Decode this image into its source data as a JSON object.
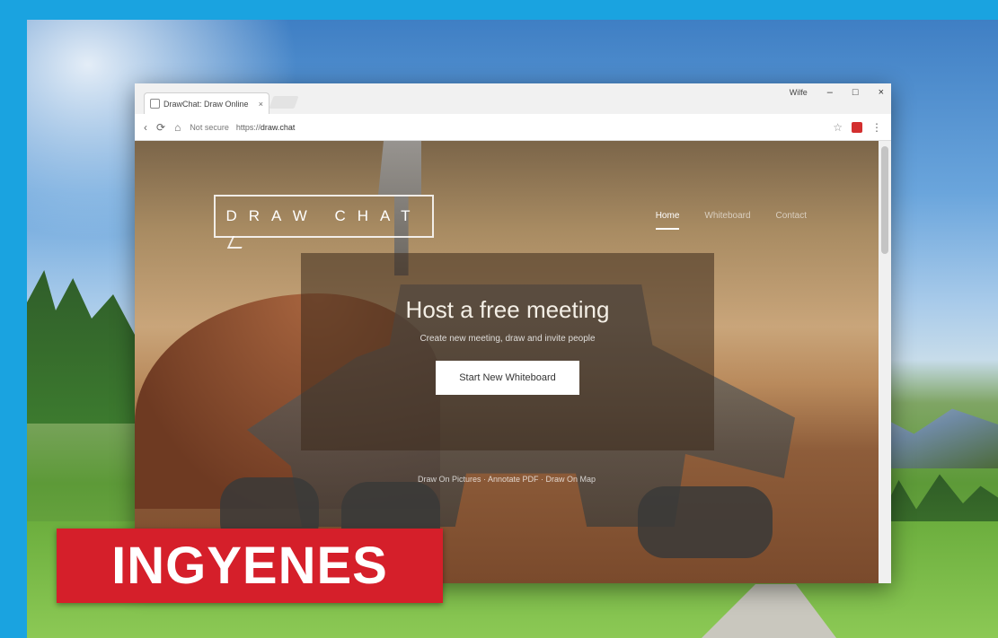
{
  "browser": {
    "tab_title": "DrawChat: Draw Online",
    "tab_close": "×",
    "window_user": "Wilfe",
    "controls": {
      "minimize": "–",
      "maximize": "□",
      "close": "×"
    },
    "nav": {
      "back": "‹",
      "reload": "⟳",
      "home": "⌂"
    },
    "secure_label": "Not secure",
    "url_prefix": "https://",
    "url_domain": "draw.chat",
    "star": "☆",
    "menu": "⋮"
  },
  "site": {
    "logo_text": "DRAW CHAT",
    "nav": [
      "Home",
      "Whiteboard",
      "Contact"
    ],
    "hero_title": "Host a free meeting",
    "hero_subtitle": "Create new meeting, draw and invite people",
    "cta_label": "Start New Whiteboard",
    "footer_links": "Draw On Pictures · Annotate PDF · Draw On Map"
  },
  "overlay": {
    "badge_text": "INGYENES"
  },
  "colors": {
    "frame": "#1aa3e0",
    "badge": "#d51f2a"
  }
}
